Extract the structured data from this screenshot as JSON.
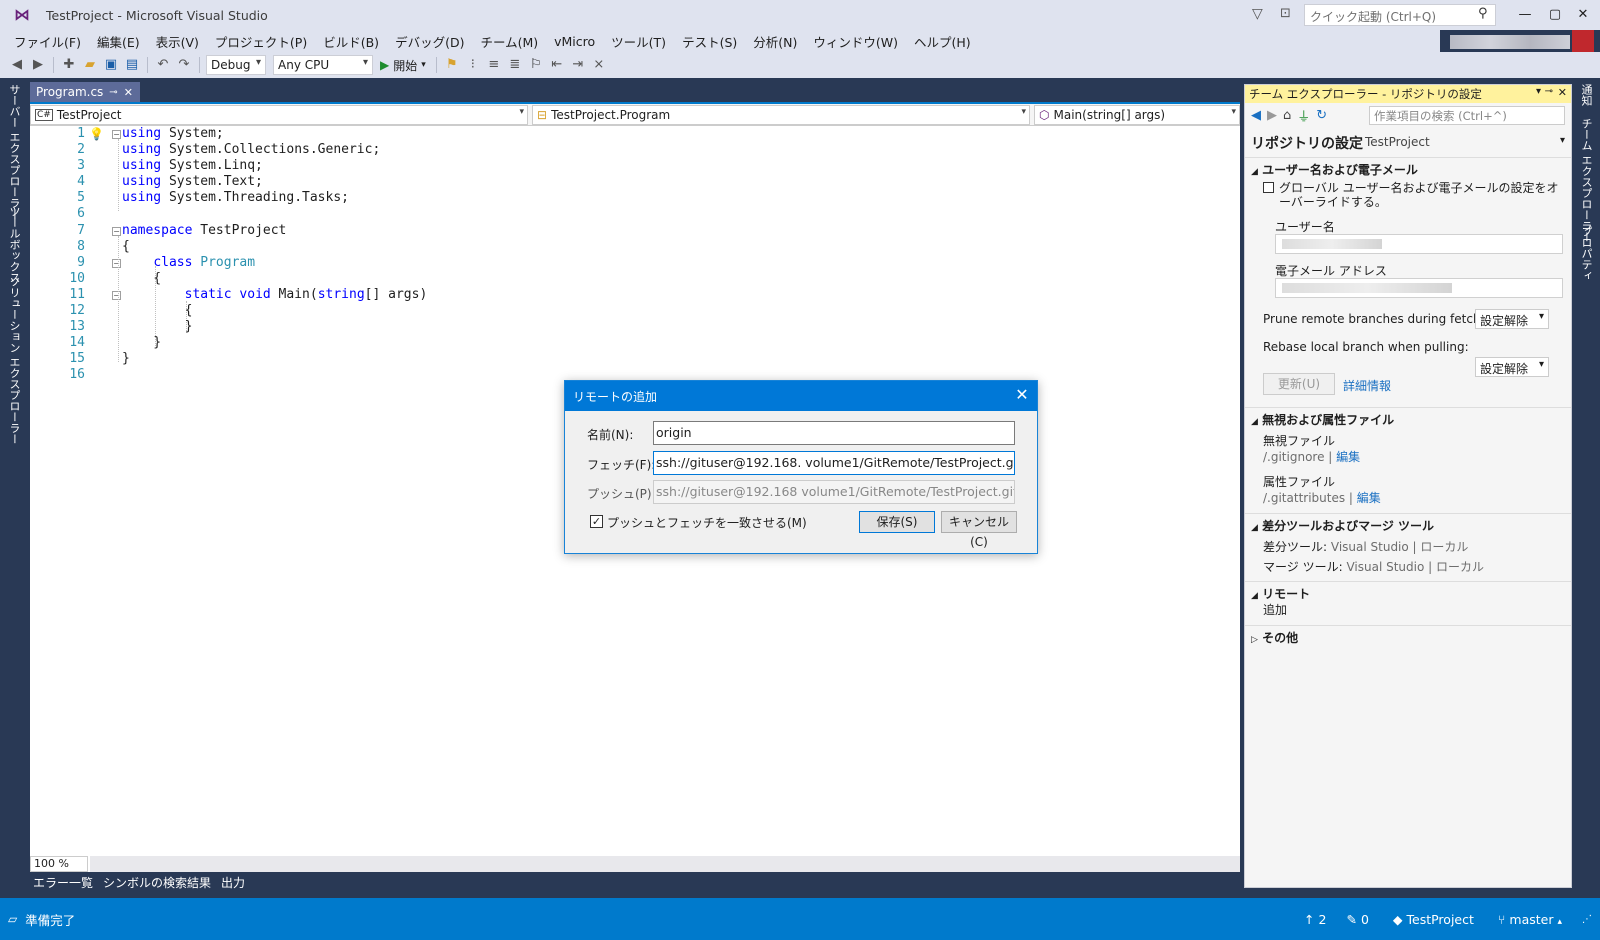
{
  "window": {
    "title": "TestProject - Microsoft Visual Studio",
    "quick_launch": "クイック起動 (Ctrl+Q)"
  },
  "menu": [
    "ファイル(F)",
    "編集(E)",
    "表示(V)",
    "プロジェクト(P)",
    "ビルド(B)",
    "デバッグ(D)",
    "チーム(M)",
    "vMicro",
    "ツール(T)",
    "テスト(S)",
    "分析(N)",
    "ウィンドウ(W)",
    "ヘルプ(H)"
  ],
  "toolbar": {
    "config": "Debug",
    "platform": "Any CPU",
    "start": "開始"
  },
  "left_strip": [
    "サーバー エクスプローラー",
    "ツールボックス",
    "ソリューション エクスプローラー"
  ],
  "right_strip": [
    "通知",
    "チーム エクスプローラー",
    "プロパティ"
  ],
  "editor": {
    "tab": "Program.cs",
    "nav": {
      "project": "TestProject",
      "class": "TestProject.Program",
      "member": "Main(string[] args)"
    },
    "zoom": "100 %",
    "lines": [
      "1",
      "2",
      "3",
      "4",
      "5",
      "6",
      "7",
      "8",
      "9",
      "10",
      "11",
      "12",
      "13",
      "14",
      "15",
      "16"
    ]
  },
  "bottom_tabs": [
    "エラー一覧",
    "シンボルの検索結果",
    "出力"
  ],
  "status": {
    "text": "準備完了",
    "up": "2",
    "pencil": "0",
    "repo": "TestProject",
    "branch": "master"
  },
  "team_explorer": {
    "header": "チーム エクスプローラー - リポジトリの設定",
    "search": "作業項目の検索 (Ctrl+^)",
    "title": "リポジトリの設定",
    "subtitle": "TestProject",
    "sec_user": "ユーザー名および電子メール",
    "override": "グローバル ユーザー名および電子メールの設定をオーバーライドする。",
    "username_label": "ユーザー名",
    "email_label": "電子メール アドレス",
    "prune_label": "Prune remote branches during fetch:",
    "prune_value": "設定解除",
    "rebase_label": "Rebase local branch when pulling:",
    "rebase_value": "設定解除",
    "update_btn": "更新(U)",
    "details_link": "詳細情報",
    "sec_ignore": "無視および属性ファイル",
    "ignore_label": "無視ファイル",
    "ignore_file": "/.gitignore",
    "edit": "編集",
    "attr_label": "属性ファイル",
    "attr_file": "/.gitattributes",
    "sec_tools": "差分ツールおよびマージ ツール",
    "diff_label": "差分ツール:",
    "merge_label": "マージ ツール:",
    "vs": "Visual Studio",
    "local": "ローカル",
    "sec_remote": "リモート",
    "add": "追加",
    "sec_other": "その他"
  },
  "dialog": {
    "title": "リモートの追加",
    "name_label": "名前(N):",
    "name_value": "origin",
    "fetch_label": "フェッチ(F):",
    "fetch_value": "ssh://gituser@192.168.      volume1/GitRemote/TestProject.git",
    "push_label": "プッシュ(P):",
    "push_value": "ssh://gituser@192.168      volume1/GitRemote/TestProject.git",
    "sync_label": "プッシュとフェッチを一致させる(M)",
    "save": "保存(S)",
    "cancel": "キャンセル(C)"
  }
}
